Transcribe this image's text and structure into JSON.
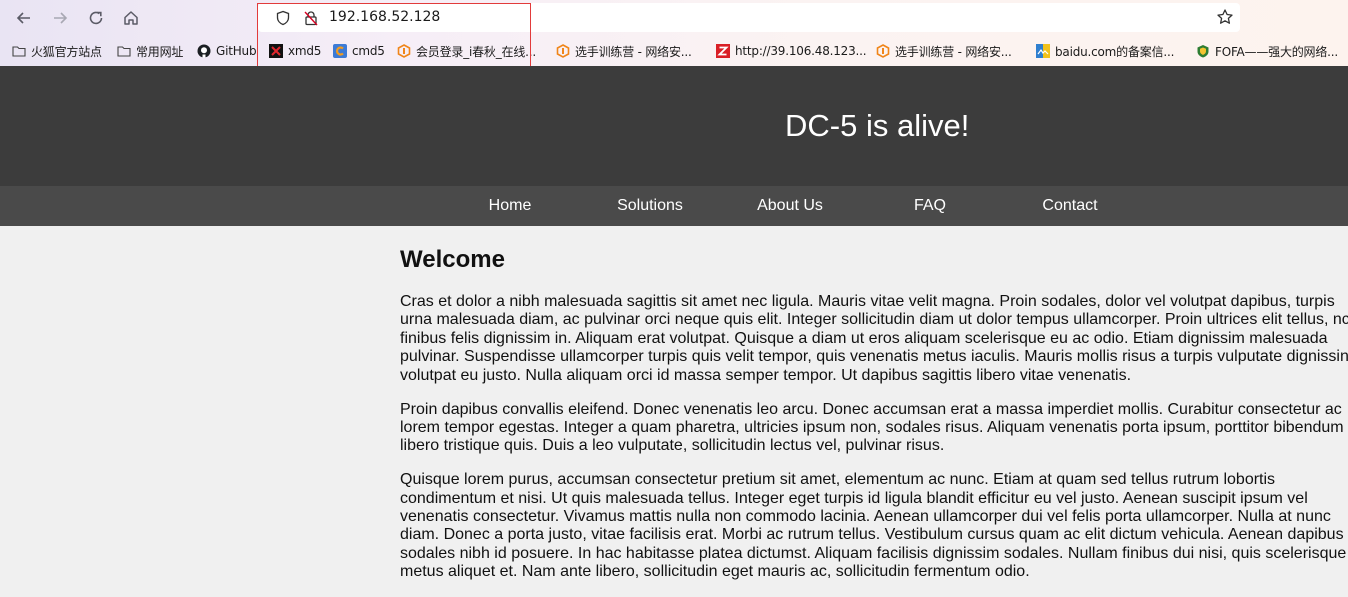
{
  "browser": {
    "url": "192.168.52.128",
    "bookmarks": [
      "火狐官方站点",
      "常用网址",
      "GitHub",
      "xmd5",
      "cmd5",
      "会员登录_i春秋_在线...",
      "选手训练营 - 网络安...",
      "http://39.106.48.123...",
      "选手训练营 - 网络安...",
      "baidu.com的备案信...",
      "FOFA——强大的网络..."
    ]
  },
  "site": {
    "title": "DC-5 is alive!",
    "nav": [
      "Home",
      "Solutions",
      "About Us",
      "FAQ",
      "Contact"
    ]
  },
  "main": {
    "heading": "Welcome",
    "paragraphs": [
      [
        "Cras et dolor a nibh malesuada sagittis sit amet nec ligula. Mauris vitae velit magna. Proin sodales, dolor vel volutpat dapibus, turpis",
        "urna malesuada diam, ac pulvinar orci neque quis elit. Integer sollicitudin diam ut dolor tempus ullamcorper. Proin ultrices elit tellus, nc",
        "finibus felis dignissim in. Aliquam erat volutpat. Quisque a diam ut eros aliquam scelerisque eu ac odio. Etiam dignissim malesuada",
        "pulvinar. Suspendisse ullamcorper turpis quis velit tempor, quis venenatis metus iaculis. Mauris mollis risus a turpis vulputate dignissin",
        "volutpat eu justo. Nulla aliquam orci id massa semper tempor. Ut dapibus sagittis libero vitae venenatis."
      ],
      [
        "Proin dapibus convallis eleifend. Donec venenatis leo arcu. Donec accumsan erat a massa imperdiet mollis. Curabitur consectetur ac",
        "lorem tempor egestas. Integer a quam pharetra, ultricies ipsum non, sodales risus. Aliquam venenatis porta ipsum, porttitor bibendum",
        "libero tristique quis. Duis a leo vulputate, sollicitudin lectus vel, pulvinar risus."
      ],
      [
        "Quisque lorem purus, accumsan consectetur pretium sit amet, elementum ac nunc. Etiam at quam sed tellus rutrum lobortis",
        "condimentum et nisi. Ut quis malesuada tellus. Integer eget turpis id ligula blandit efficitur eu vel justo. Aenean suscipit ipsum vel",
        "venenatis consectetur. Vivamus mattis nulla non commodo lacinia. Aenean ullamcorper dui vel felis porta ullamcorper. Nulla at nunc",
        "diam. Donec a porta justo, vitae facilisis erat. Morbi ac rutrum tellus. Vestibulum cursus quam ac elit dictum vehicula. Aenean dapibus",
        "sodales nibh id posuere. In hac habitasse platea dictumst. Aliquam facilisis dignissim sodales. Nullam finibus dui nisi, quis scelerisque",
        "metus aliquet et. Nam ante libero, sollicitudin eget mauris ac, sollicitudin fermentum odio."
      ]
    ]
  }
}
